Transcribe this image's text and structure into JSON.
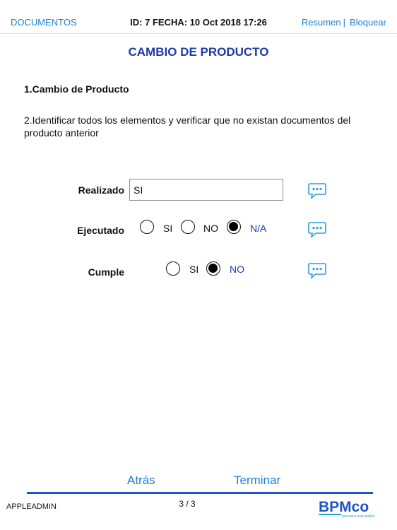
{
  "header": {
    "documents_label": "DOCUMENTOS",
    "session_info": "ID: 7 FECHA: 10 Oct 2018 17:26",
    "summary_label": "Resumen",
    "separator": "|",
    "lock_label": "Bloquear"
  },
  "main": {
    "title": "CAMBIO DE PRODUCTO",
    "item_1": "1.Cambio de Producto",
    "item_2": "2.Identificar todos los elementos y verificar que no existan documentos del producto anterior"
  },
  "form": {
    "realizado": {
      "label": "Realizado",
      "value": "SI"
    },
    "ejecutado": {
      "label": "Ejecutado",
      "options": [
        "SI",
        "NO",
        "N/A"
      ],
      "selected": "N/A"
    },
    "cumple": {
      "label": "Cumple",
      "options": [
        "SI",
        "NO"
      ],
      "selected": "NO"
    }
  },
  "footer": {
    "back_label": "Atrás",
    "finish_label": "Terminar",
    "user": "APPLEADMIN",
    "page_indicator": "3 / 3",
    "logo_text": "BPMco",
    "logo_tagline": "procesos más fáciles"
  },
  "colors": {
    "link": "#1f7fd1",
    "title": "#1f3aa8",
    "rule": "#1f55c8",
    "comment_icon": "#2a9fd6"
  }
}
